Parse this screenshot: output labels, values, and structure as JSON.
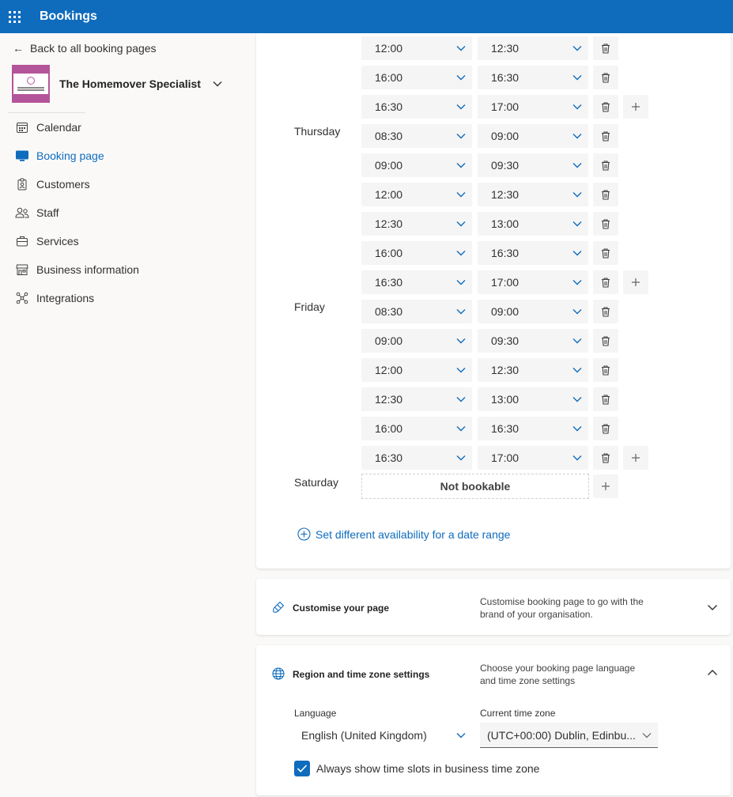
{
  "app": {
    "title": "Bookings"
  },
  "sidebar": {
    "back_label": "Back to all booking pages",
    "org_name": "The Homemover Specialist",
    "items": [
      {
        "label": "Calendar",
        "icon": "calendar-icon"
      },
      {
        "label": "Booking page",
        "icon": "booking-page-icon",
        "active": true
      },
      {
        "label": "Customers",
        "icon": "customers-icon"
      },
      {
        "label": "Staff",
        "icon": "staff-icon"
      },
      {
        "label": "Services",
        "icon": "services-icon"
      },
      {
        "label": "Business information",
        "icon": "business-icon"
      },
      {
        "label": "Integrations",
        "icon": "integrations-icon"
      }
    ]
  },
  "availability": {
    "days": [
      {
        "name": "",
        "slots": [
          {
            "start": "12:00",
            "end": "12:30"
          },
          {
            "start": "16:00",
            "end": "16:30"
          },
          {
            "start": "16:30",
            "end": "17:00",
            "add": true
          }
        ]
      },
      {
        "name": "Thursday",
        "slots": [
          {
            "start": "08:30",
            "end": "09:00"
          },
          {
            "start": "09:00",
            "end": "09:30"
          },
          {
            "start": "12:00",
            "end": "12:30"
          },
          {
            "start": "12:30",
            "end": "13:00"
          },
          {
            "start": "16:00",
            "end": "16:30"
          },
          {
            "start": "16:30",
            "end": "17:00",
            "add": true
          }
        ]
      },
      {
        "name": "Friday",
        "slots": [
          {
            "start": "08:30",
            "end": "09:00"
          },
          {
            "start": "09:00",
            "end": "09:30"
          },
          {
            "start": "12:00",
            "end": "12:30"
          },
          {
            "start": "12:30",
            "end": "13:00"
          },
          {
            "start": "16:00",
            "end": "16:30"
          },
          {
            "start": "16:30",
            "end": "17:00",
            "add": true
          }
        ]
      }
    ],
    "saturday_label": "Saturday",
    "not_bookable": "Not bookable",
    "date_range_link": "Set different availability for a date range"
  },
  "customise": {
    "title": "Customise your page",
    "desc": "Customise booking page to go with the brand of your organisation."
  },
  "region": {
    "title": "Region and time zone settings",
    "desc": "Choose your booking page language and time zone settings",
    "language_label": "Language",
    "language_value": "English (United Kingdom)",
    "timezone_label": "Current time zone",
    "timezone_value": "(UTC+00:00) Dublin, Edinbu...",
    "checkbox_label": "Always show time slots in business time zone",
    "checkbox_checked": true
  },
  "colors": {
    "accent": "#0f6cbd",
    "logo": "#b4549a"
  }
}
